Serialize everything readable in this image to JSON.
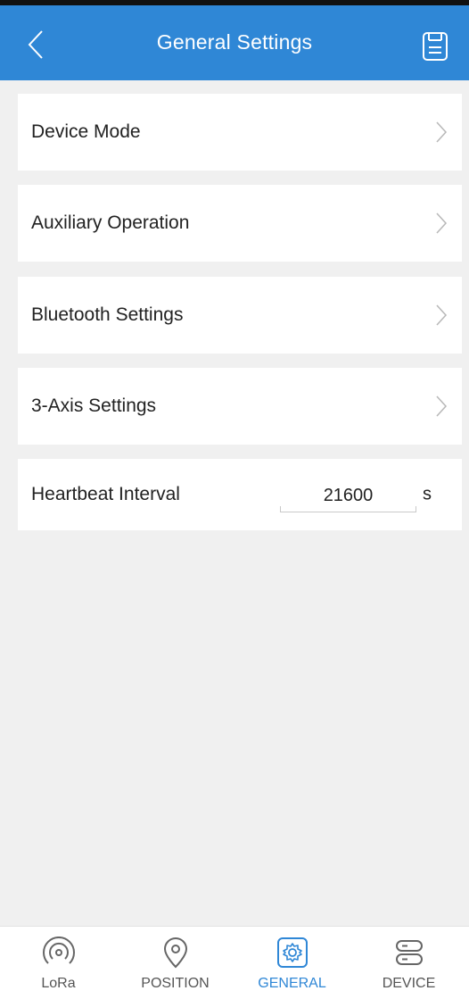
{
  "header": {
    "title": "General Settings",
    "back_icon": "chevron-left-icon",
    "save_icon": "save-icon",
    "background": "#2f87d6"
  },
  "menu": {
    "items": [
      {
        "label": "Device Mode",
        "icon": "chevron-right-icon"
      },
      {
        "label": "Auxiliary Operation",
        "icon": "chevron-right-icon"
      },
      {
        "label": "Bluetooth Settings",
        "icon": "chevron-right-icon"
      },
      {
        "label": "3-Axis Settings",
        "icon": "chevron-right-icon"
      }
    ],
    "heartbeat": {
      "label": "Heartbeat Interval",
      "value": "21600",
      "unit": "s"
    }
  },
  "tabs": [
    {
      "label": "LoRa",
      "icon": "lora-signal-icon",
      "active": false
    },
    {
      "label": "POSITION",
      "icon": "location-pin-icon",
      "active": false
    },
    {
      "label": "GENERAL",
      "icon": "gear-icon",
      "active": true
    },
    {
      "label": "DEVICE",
      "icon": "device-icon",
      "active": false
    }
  ],
  "colors": {
    "accent": "#2f87d6",
    "background": "#f0f0f0",
    "card": "#ffffff",
    "inactive": "#555555"
  }
}
